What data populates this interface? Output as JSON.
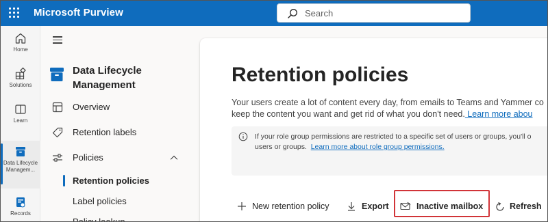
{
  "app": {
    "title": "Microsoft Purview"
  },
  "search": {
    "placeholder": "Search"
  },
  "rail": [
    {
      "label": "Home",
      "icon": "home-icon"
    },
    {
      "label": "Solutions",
      "icon": "solutions-icon"
    },
    {
      "label": "Learn",
      "icon": "learn-icon"
    },
    {
      "label": "Data Lifecycle Managem...",
      "icon": "data-lifecycle-icon",
      "active": true
    },
    {
      "label": "Records",
      "icon": "records-icon"
    }
  ],
  "nav": {
    "heading_line1": "Data Lifecycle",
    "heading_line2": "Management",
    "items": [
      {
        "label": "Overview",
        "icon": "overview-icon"
      },
      {
        "label": "Retention labels",
        "icon": "tag-icon"
      },
      {
        "label": "Policies",
        "icon": "policies-icon",
        "expanded": true
      }
    ],
    "subitems": [
      {
        "label": "Retention policies",
        "selected": true
      },
      {
        "label": "Label policies"
      },
      {
        "label": "Policy lookup"
      }
    ]
  },
  "main": {
    "title": "Retention policies",
    "desc_line1": "Your users create a lot of content every day, from emails to Teams and Yammer co",
    "desc_line2": "keep the content you want and get rid of what you don't need.",
    "desc_link": " Learn more abou",
    "info_line1": "If your role group permissions are restricted to a specific set of users or groups, you'll o",
    "info_line2_prefix": "users or groups.",
    "info_link": "Learn more about role group permissions."
  },
  "toolbar": {
    "new_label": "New retention policy",
    "export_label": "Export",
    "inactive_label": "Inactive mailbox",
    "refresh_label": "Refresh"
  },
  "colors": {
    "brand": "#0f6cbd",
    "highlight": "#d13438"
  }
}
